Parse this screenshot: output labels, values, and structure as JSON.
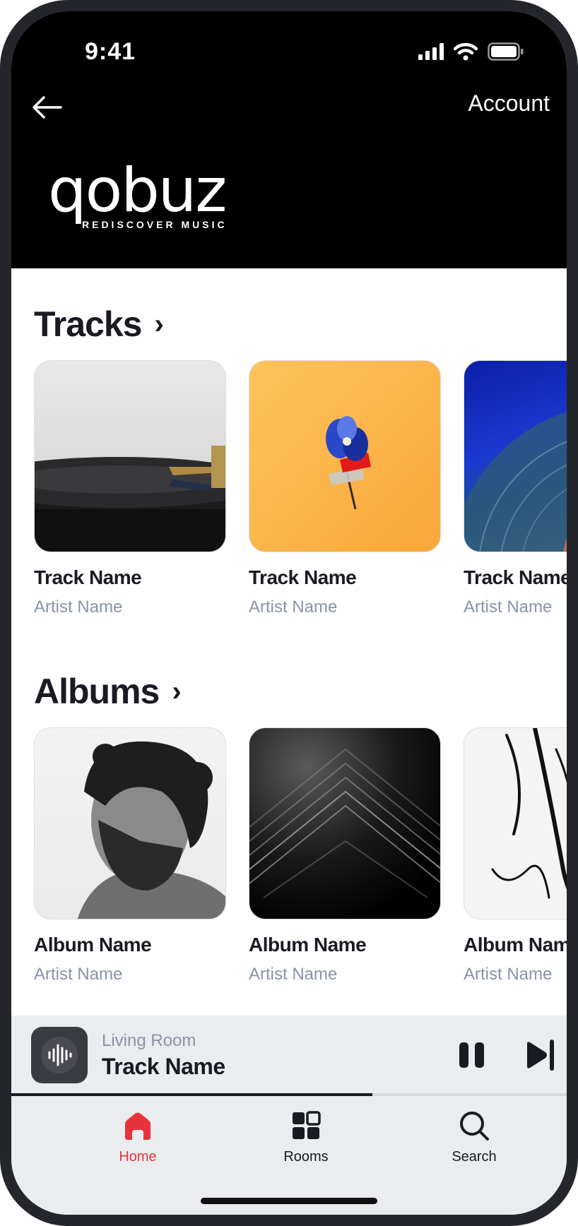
{
  "status_bar": {
    "time": "9:41"
  },
  "header": {
    "account_label": "Account",
    "logo_word": "qobuz",
    "logo_tagline": "REDISCOVER MUSIC"
  },
  "tracks": {
    "title": "Tracks",
    "items": [
      {
        "title": "Track Name",
        "artist": "Artist Name"
      },
      {
        "title": "Track Name",
        "artist": "Artist Name"
      },
      {
        "title": "Track Name",
        "artist": "Artist Name"
      }
    ]
  },
  "albums": {
    "title": "Albums",
    "items": [
      {
        "title": "Album Name",
        "artist": "Artist Name"
      },
      {
        "title": "Album Name",
        "artist": "Artist Name"
      },
      {
        "title": "Album Name",
        "artist": "Artist Name"
      }
    ]
  },
  "player": {
    "room": "Living Room",
    "track": "Track Name",
    "progress_fraction": 0.65
  },
  "tabs": [
    {
      "label": "Home",
      "icon": "home-icon",
      "active": true
    },
    {
      "label": "Rooms",
      "icon": "rooms-grid-icon",
      "active": false
    },
    {
      "label": "Search",
      "icon": "search-icon",
      "active": false
    }
  ],
  "colors": {
    "accent": "#e8333b",
    "header_bg": "#000000",
    "muted_text": "#8b93a8"
  }
}
